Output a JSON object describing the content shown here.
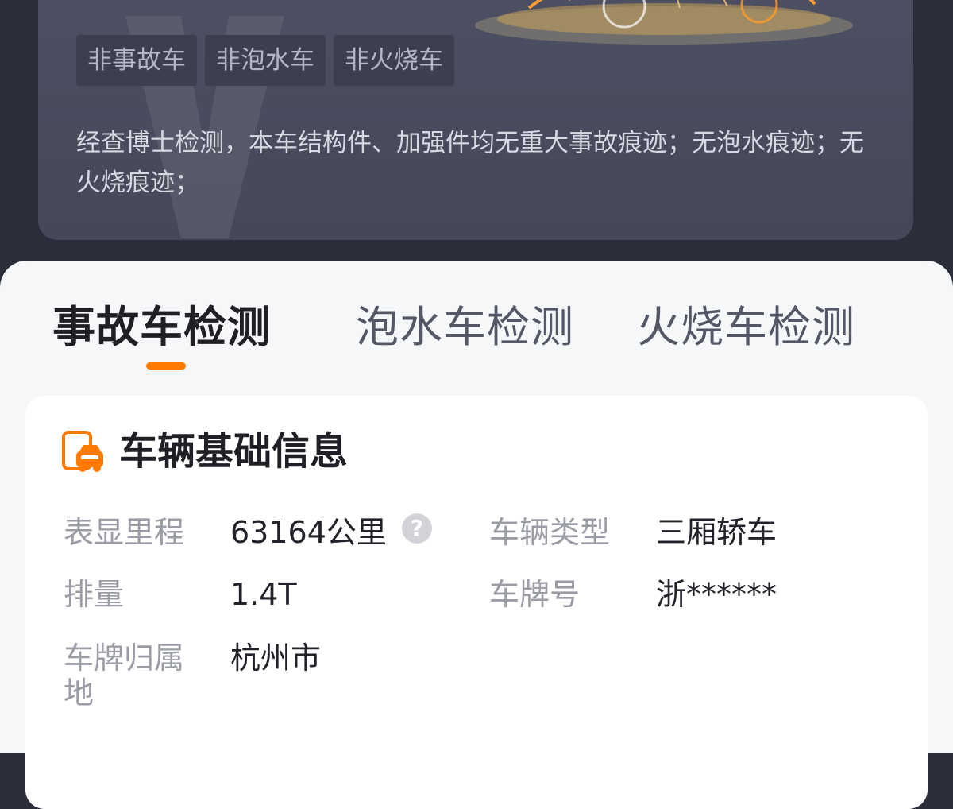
{
  "check_summary": {
    "tags": [
      "非事故车",
      "非泡水车",
      "非火烧车"
    ],
    "description": "经查博士检测，本车结构件、加强件均无重大事故痕迹；无泡水痕迹；无火烧痕迹；"
  },
  "tabs": [
    {
      "label": "事故车检测",
      "active": true
    },
    {
      "label": "泡水车检测",
      "active": false
    },
    {
      "label": "火烧车检测",
      "active": false
    }
  ],
  "basic_info": {
    "title": "车辆基础信息",
    "icon": "car-document-icon",
    "fields": {
      "mileage": {
        "label": "表显里程",
        "value": "63164公里"
      },
      "vehicle_type": {
        "label": "车辆类型",
        "value": "三厢轿车"
      },
      "displacement": {
        "label": "排量",
        "value": "1.4T"
      },
      "plate": {
        "label": "车牌号",
        "value": "浙******"
      },
      "plate_city": {
        "label": "车牌归属地",
        "value": "杭州市"
      }
    }
  },
  "colors": {
    "accent": "#ff7a00",
    "dark_bg": "#2c2d3b",
    "card_bg": "#4d5063"
  }
}
